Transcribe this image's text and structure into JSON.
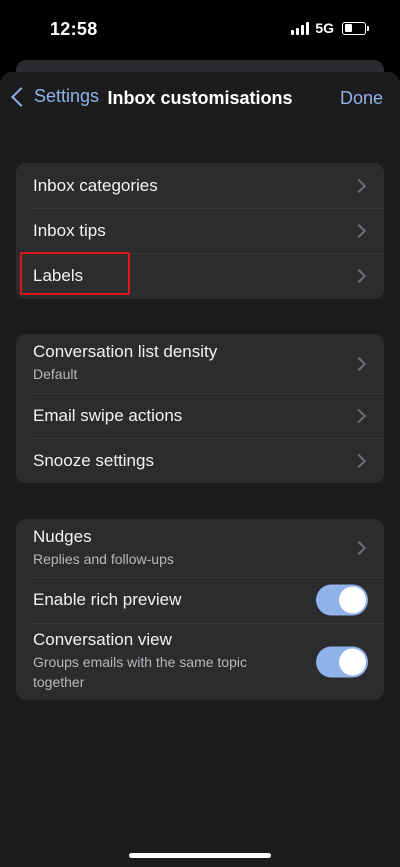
{
  "status_bar": {
    "time": "12:58",
    "network": "5G",
    "icons": [
      "signal-icon",
      "battery-icon"
    ]
  },
  "nav": {
    "back_label": "Settings",
    "title": "Inbox customisations",
    "done_label": "Done"
  },
  "groups": [
    {
      "rows": [
        {
          "label": "Inbox categories",
          "accessory": "chevron"
        },
        {
          "label": "Inbox tips",
          "accessory": "chevron"
        },
        {
          "label": "Labels",
          "accessory": "chevron",
          "highlighted": true
        }
      ]
    },
    {
      "rows": [
        {
          "label": "Conversation list density",
          "subtitle": "Default",
          "accessory": "chevron"
        },
        {
          "label": "Email swipe actions",
          "accessory": "chevron"
        },
        {
          "label": "Snooze settings",
          "accessory": "chevron"
        }
      ]
    },
    {
      "rows": [
        {
          "label": "Nudges",
          "subtitle": "Replies and follow-ups",
          "accessory": "chevron"
        },
        {
          "label": "Enable rich preview",
          "accessory": "toggle",
          "on": true
        },
        {
          "label": "Conversation view",
          "subtitle": "Groups emails with the same topic together",
          "accessory": "toggle",
          "on": true
        }
      ]
    }
  ],
  "colors": {
    "accent": "#8fb2e8",
    "highlight_border": "#e0141e",
    "sheet_bg": "#1c1c1e",
    "group_bg": "#2c2c2e"
  }
}
